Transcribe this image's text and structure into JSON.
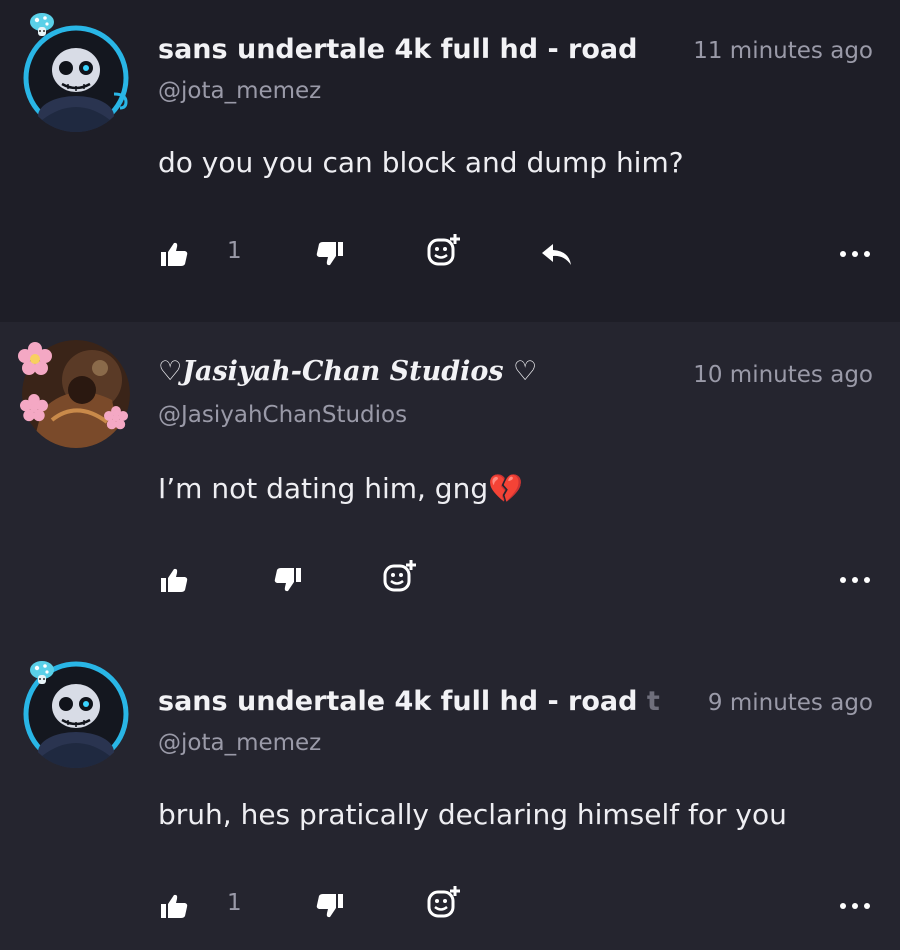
{
  "comments": [
    {
      "author": "sans undertale 4k full hd - road",
      "author_tail": "",
      "time": "11 minutes ago",
      "handle": "@jota_memez",
      "text": "do you you can block and dump him?",
      "likes": "1",
      "avatar_icon": "sans-skull-avatar",
      "has_reply": true
    },
    {
      "author": "♡Jasiyah-Chan Studios ♡",
      "author_tail": "",
      "time": "10 minutes ago",
      "handle": "@JasiyahChanStudios",
      "text": "I’m not dating him, gng💔",
      "likes": "",
      "avatar_icon": "artwork-avatar",
      "has_reply": false
    },
    {
      "author": "sans undertale 4k full hd - road",
      "author_tail": "t",
      "time": "9 minutes ago",
      "handle": "@jota_memez",
      "text": "bruh, hes pratically declaring himself for you",
      "likes": "1",
      "avatar_icon": "sans-skull-avatar",
      "has_reply": false
    }
  ],
  "colors": {
    "background": "#23232d",
    "first_comment_bg": "#1e1e27",
    "text_primary": "#f2f2f5",
    "text_secondary": "#9a9aa8",
    "avatar_ring": "#29b6e6",
    "broken_heart": "#e0245e"
  },
  "icons": [
    "thumbs-up-icon",
    "thumbs-down-icon",
    "add-reaction-icon",
    "reply-icon",
    "more-options-icon"
  ]
}
